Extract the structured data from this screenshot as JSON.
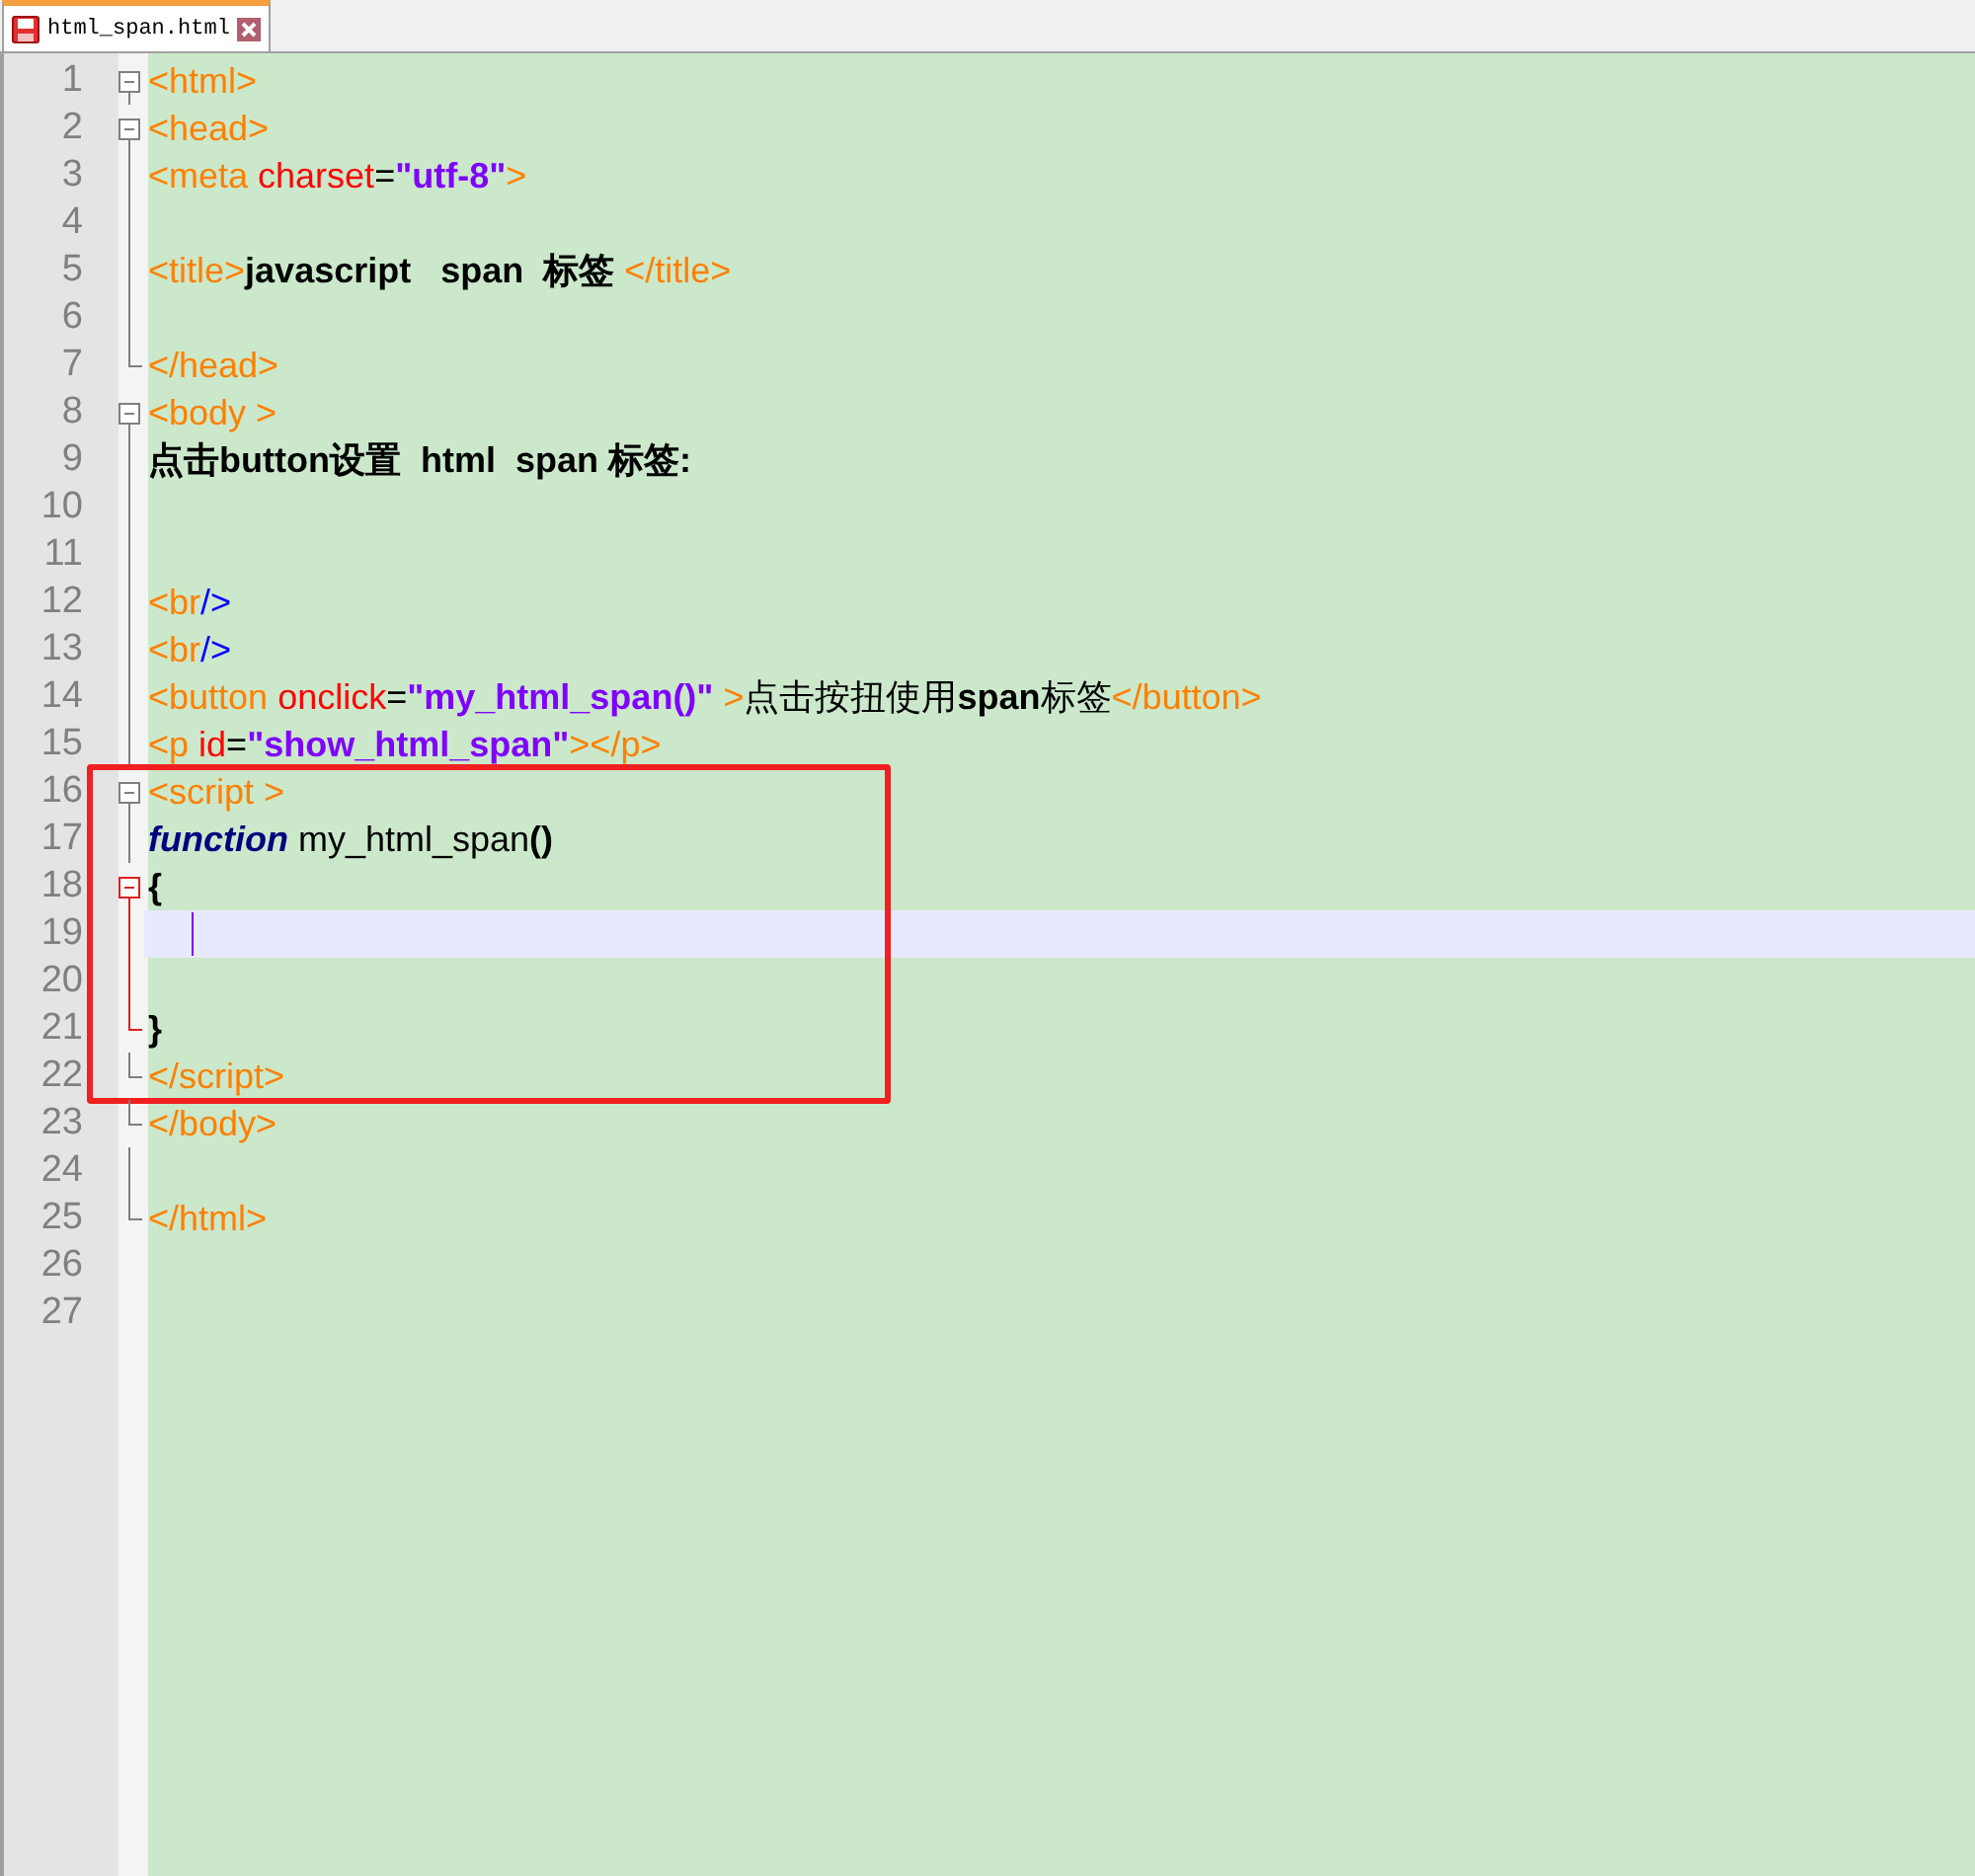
{
  "tab": {
    "label": "html_span.html",
    "selected": true
  },
  "blocks": [
    {
      "kind": "plain",
      "lines": [
        {
          "number": "1",
          "fold": {
            "kind": "start",
            "color": "#808080"
          },
          "current": false,
          "tokens": [
            {
              "kind": "tag",
              "text": "<html>"
            }
          ]
        },
        {
          "number": "2",
          "fold": {
            "kind": "start",
            "color": "#808080"
          },
          "current": false,
          "tokens": [
            {
              "kind": "tag",
              "text": "<head>"
            }
          ]
        },
        {
          "number": "3",
          "fold": {
            "kind": "line",
            "color": "#808080"
          },
          "current": false,
          "tokens": [
            {
              "kind": "tag",
              "text": "<meta "
            },
            {
              "kind": "attr",
              "text": "charset"
            },
            {
              "kind": "plain",
              "text": "="
            },
            {
              "kind": "value",
              "text": "\"utf-8\""
            },
            {
              "kind": "tag",
              "text": ">"
            }
          ]
        },
        {
          "number": "4",
          "fold": {
            "kind": "line",
            "color": "#808080"
          },
          "current": false
        },
        {
          "number": "5",
          "fold": {
            "kind": "line",
            "color": "#808080"
          },
          "current": false,
          "tokens": [
            {
              "kind": "tag",
              "text": "<title>"
            },
            {
              "kind": "text",
              "text": "javascript   span  标签 "
            },
            {
              "kind": "tag",
              "text": "</title>"
            }
          ]
        },
        {
          "number": "6",
          "fold": {
            "kind": "line",
            "color": "#808080"
          },
          "current": false
        },
        {
          "number": "7",
          "fold": {
            "kind": "end",
            "color": "#808080"
          },
          "current": false,
          "tokens": [
            {
              "kind": "tag",
              "text": "</head>"
            }
          ]
        },
        {
          "number": "8",
          "fold": {
            "kind": "start",
            "color": "#808080"
          },
          "current": false,
          "tokens": [
            {
              "kind": "tag",
              "text": "<body >"
            }
          ]
        },
        {
          "number": "9",
          "fold": {
            "kind": "line",
            "color": "#808080"
          },
          "current": false,
          "tokens": [
            {
              "kind": "text",
              "text": "点击button设置  html  span 标签:"
            }
          ]
        },
        {
          "number": "10",
          "fold": {
            "kind": "line",
            "color": "#808080"
          },
          "current": false
        },
        {
          "number": "11",
          "fold": {
            "kind": "line",
            "color": "#808080"
          },
          "current": false
        },
        {
          "number": "12",
          "fold": {
            "kind": "line",
            "color": "#808080"
          },
          "current": false,
          "tokens": [
            {
              "kind": "tag",
              "text": "<br"
            },
            {
              "kind": "slash",
              "text": "/>"
            }
          ]
        },
        {
          "number": "13",
          "fold": {
            "kind": "line",
            "color": "#808080"
          },
          "current": false,
          "tokens": [
            {
              "kind": "tag",
              "text": "<br"
            },
            {
              "kind": "slash",
              "text": "/>"
            }
          ]
        },
        {
          "number": "14",
          "fold": {
            "kind": "line",
            "color": "#808080"
          },
          "current": false,
          "tokens": [
            {
              "kind": "tag",
              "text": "<button "
            },
            {
              "kind": "attr",
              "text": "onclick"
            },
            {
              "kind": "plain",
              "text": "="
            },
            {
              "kind": "value",
              "text": "\"my_html_span()\""
            },
            {
              "kind": "tag",
              "text": " >"
            },
            {
              "kind": "plain",
              "text": "点击按扭使用"
            },
            {
              "kind": "text",
              "text": "span"
            },
            {
              "kind": "plain",
              "text": "标签"
            },
            {
              "kind": "tag",
              "text": "</button>"
            }
          ]
        },
        {
          "number": "15",
          "fold": {
            "kind": "line",
            "color": "#808080"
          },
          "current": false,
          "tokens": [
            {
              "kind": "tag",
              "text": "<p "
            },
            {
              "kind": "attr",
              "text": "id"
            },
            {
              "kind": "plain",
              "text": "="
            },
            {
              "kind": "value",
              "text": "\"show_html_span\""
            },
            {
              "kind": "tag",
              "text": "></p>"
            }
          ]
        }
      ]
    },
    {
      "kind": "boxed",
      "lines": [
        {
          "number": "16",
          "fold": {
            "kind": "start",
            "color": "#808080"
          },
          "current": false,
          "tokens": [
            {
              "kind": "tag",
              "text": "<script >"
            }
          ]
        },
        {
          "number": "17",
          "fold": {
            "kind": "line",
            "color": "#808080"
          },
          "current": false,
          "tokens": [
            {
              "kind": "keyword",
              "text": "function"
            },
            {
              "kind": "plain",
              "text": " my_html_span"
            },
            {
              "kind": "text",
              "text": "()"
            }
          ]
        },
        {
          "number": "18",
          "fold": {
            "kind": "start",
            "color": "#e02020"
          },
          "current": false,
          "tokens": [
            {
              "kind": "text",
              "text": "{"
            }
          ]
        },
        {
          "number": "19",
          "fold": {
            "kind": "line",
            "color": "#e02020"
          },
          "current": true
        },
        {
          "number": "20",
          "fold": {
            "kind": "line",
            "color": "#e02020"
          },
          "current": false
        },
        {
          "number": "21",
          "fold": {
            "kind": "end",
            "color": "#e02020"
          },
          "current": false,
          "tokens": [
            {
              "kind": "text",
              "text": "}"
            }
          ]
        },
        {
          "number": "22",
          "fold": {
            "kind": "end",
            "color": "#808080"
          },
          "current": false,
          "tokens": [
            {
              "kind": "tag",
              "text": "</script>"
            }
          ]
        }
      ]
    },
    {
      "kind": "plain",
      "lines": [
        {
          "number": "23",
          "fold": {
            "kind": "end",
            "color": "#808080"
          },
          "current": false,
          "tokens": [
            {
              "kind": "tag",
              "text": "</body>"
            }
          ]
        },
        {
          "number": "24",
          "fold": {
            "kind": "line",
            "color": "#808080"
          },
          "current": false
        },
        {
          "number": "25",
          "fold": {
            "kind": "end",
            "color": "#808080"
          },
          "current": false,
          "tokens": [
            {
              "kind": "tag",
              "text": "</html>"
            }
          ]
        },
        {
          "number": "26",
          "current": false
        },
        {
          "number": "27",
          "current": false
        }
      ]
    }
  ]
}
